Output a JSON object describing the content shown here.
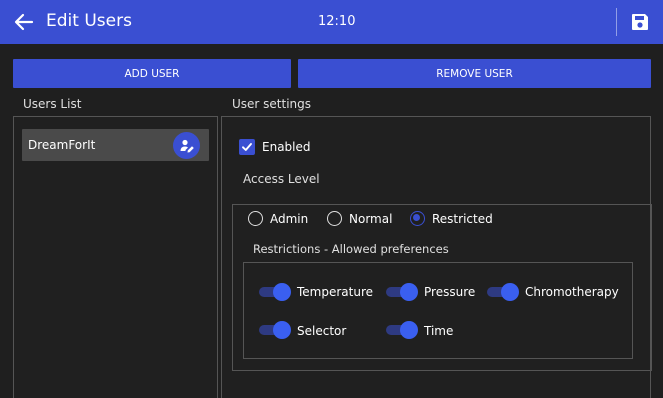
{
  "header": {
    "title": "Edit Users",
    "time": "12:10"
  },
  "actions": {
    "add_user": "ADD USER",
    "remove_user": "REMOVE USER"
  },
  "users_list": {
    "label": "Users List",
    "users": [
      {
        "name": "DreamForIt"
      }
    ]
  },
  "settings": {
    "label": "User settings",
    "enabled_label": "Enabled",
    "enabled": true,
    "access_level_label": "Access Level",
    "access_options": [
      "Admin",
      "Normal",
      "Restricted"
    ],
    "access_selected": "Restricted",
    "restrictions_label": "Restrictions - Allowed preferences",
    "preferences": [
      {
        "label": "Temperature",
        "on": true
      },
      {
        "label": "Pressure",
        "on": true
      },
      {
        "label": "Chromotherapy",
        "on": true
      },
      {
        "label": "Selector",
        "on": true
      },
      {
        "label": "Time",
        "on": true
      }
    ]
  },
  "colors": {
    "accent": "#3a4fd2",
    "background": "#1f1f1f",
    "panel_border": "#555555"
  },
  "icons": {
    "back": "arrow-left-icon",
    "save": "floppy-disk-icon",
    "edit_user": "user-edit-icon",
    "check": "checkmark-icon"
  }
}
